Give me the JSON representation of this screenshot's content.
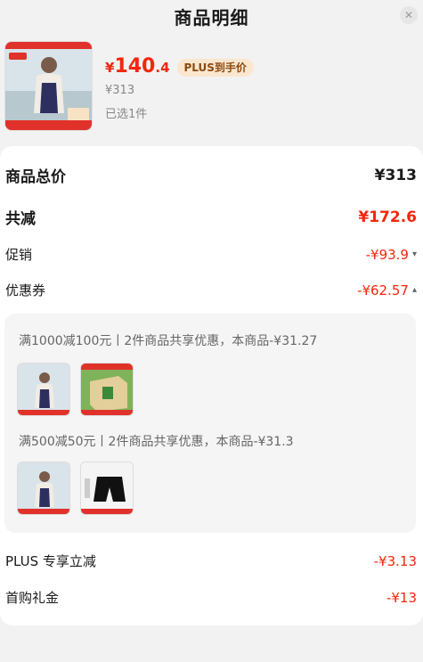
{
  "header": {
    "title": "商品明细",
    "close_icon": "close-icon"
  },
  "product": {
    "price_currency": "¥",
    "price_int": "140",
    "price_dec": ".4",
    "plus_badge": "PLUS到手价",
    "original_price": "¥313",
    "selected_count": "已选1件"
  },
  "summary": {
    "total_label": "商品总价",
    "total_value": "¥313",
    "reduce_label": "共减",
    "reduce_value": "¥172.6",
    "promo_label": "促销",
    "promo_value": "-¥93.9",
    "coupon_label": "优惠券",
    "coupon_value": "-¥62.57"
  },
  "coupons": [
    {
      "text": "满1000减100元丨2件商品共享优惠，本商品-¥31.27"
    },
    {
      "text": "满500减50元丨2件商品共享优惠，本商品-¥31.3"
    }
  ],
  "extras": {
    "plus_label": "PLUS 专享立减",
    "plus_value": "-¥3.13",
    "first_label": "首购礼金",
    "first_value": "-¥13"
  },
  "colors": {
    "accent": "#f2270c",
    "badge_bg": "#fbe7cf"
  }
}
